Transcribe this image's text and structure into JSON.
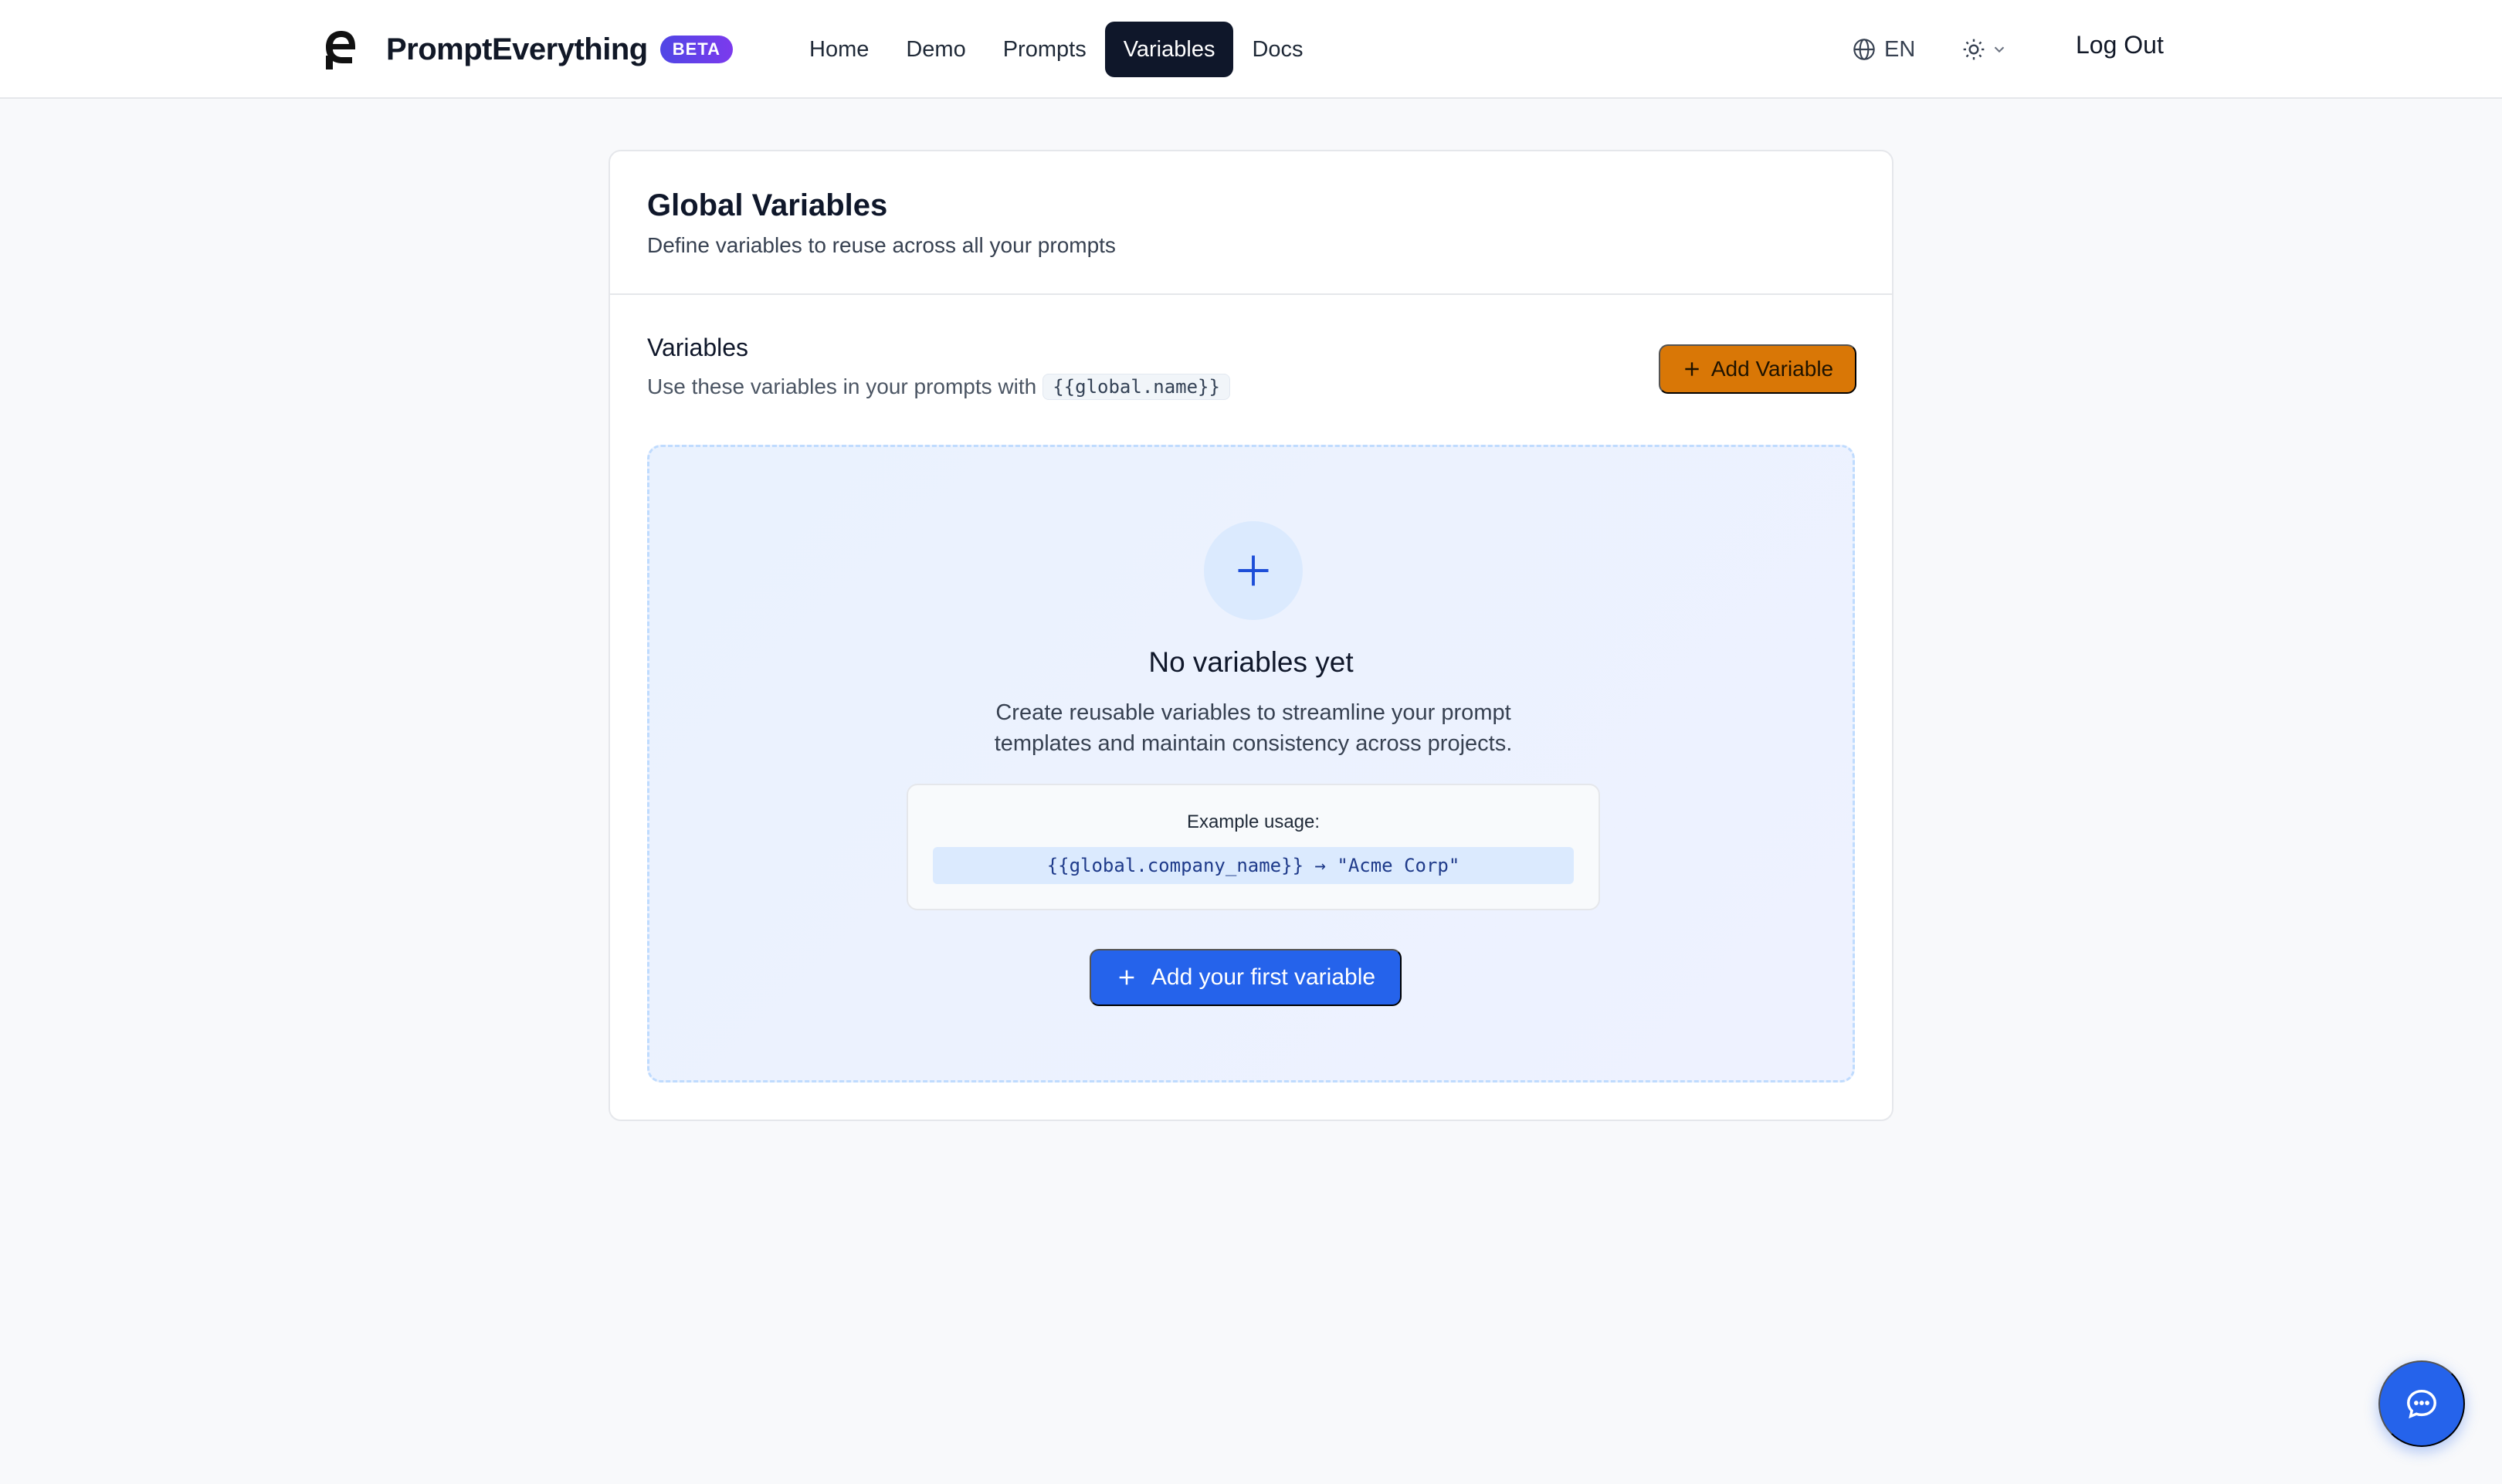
{
  "header": {
    "brand_name": "PromptEverything",
    "badge": "BETA",
    "nav": [
      {
        "label": "Home",
        "active": false
      },
      {
        "label": "Demo",
        "active": false
      },
      {
        "label": "Prompts",
        "active": false
      },
      {
        "label": "Variables",
        "active": true
      },
      {
        "label": "Docs",
        "active": false
      }
    ],
    "language": "EN",
    "theme_icon": "sun-icon",
    "logout_label": "Log Out"
  },
  "page": {
    "title": "Global Variables",
    "description": "Define variables to reuse across all your prompts"
  },
  "variables_section": {
    "title": "Variables",
    "description": "Use these variables in your prompts with",
    "syntax_example": "{{global.name}}",
    "add_button_label": "Add Variable"
  },
  "empty_state": {
    "title": "No variables yet",
    "description": "Create reusable variables to streamline your prompt templates and maintain consistency across projects.",
    "example_label": "Example usage:",
    "example_code": "{{global.company_name}} → \"Acme Corp\"",
    "cta_label": "Add your first variable"
  },
  "colors": {
    "accent_blue": "#2563eb",
    "accent_orange": "#d97706",
    "nav_active": "#0f172a",
    "badge_gradient": [
      "#4f46e5",
      "#7c3aed"
    ]
  },
  "icons": {
    "chat_fab": "chat-bubble-icon",
    "language": "globe-icon"
  }
}
